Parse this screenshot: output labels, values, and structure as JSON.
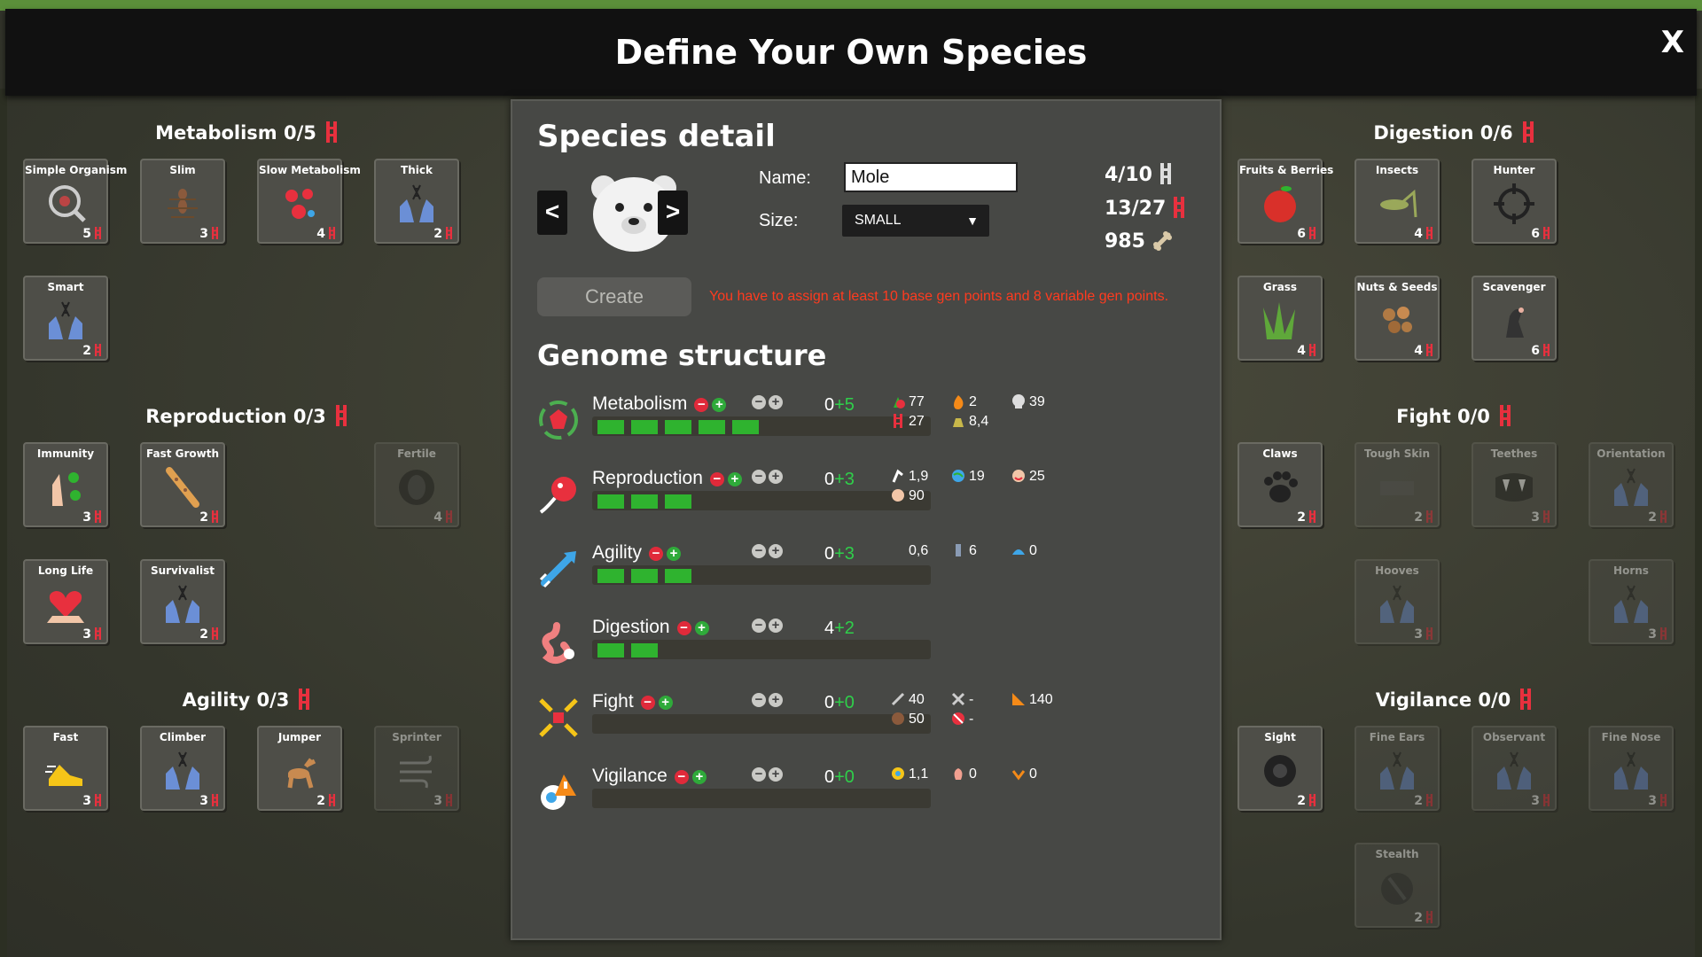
{
  "window": {
    "title": "Define Your Own Species",
    "close_label": "X"
  },
  "left_groups": [
    {
      "title": "Metabolism 0/5",
      "cards": [
        {
          "label": "Simple Organism",
          "cost": "5",
          "icon": "magnifier-bug-icon"
        },
        {
          "label": "Slim",
          "cost": "3",
          "icon": "ant-icon"
        },
        {
          "label": "Slow Metabolism",
          "cost": "4",
          "icon": "virus-icon"
        },
        {
          "label": "Thick",
          "cost": "2",
          "icon": "hands-dna-icon"
        },
        {
          "label": "Smart",
          "cost": "2",
          "icon": "hands-dna-icon"
        }
      ]
    },
    {
      "title": "Reproduction 0/3",
      "cards": [
        {
          "label": "Immunity",
          "cost": "3",
          "icon": "hand-virus-icon"
        },
        {
          "label": "Fast Growth",
          "cost": "2",
          "icon": "giraffe-icon"
        },
        {
          "label": "Fertile",
          "cost": "4",
          "icon": "egg-icon"
        },
        {
          "label": "Long Life",
          "cost": "3",
          "icon": "heart-hand-icon"
        },
        {
          "label": "Survivalist",
          "cost": "2",
          "icon": "hands-dna-icon"
        }
      ]
    },
    {
      "title": "Agility 0/3",
      "cards": [
        {
          "label": "Fast",
          "cost": "3",
          "icon": "shoe-icon"
        },
        {
          "label": "Climber",
          "cost": "3",
          "icon": "hands-dna-icon"
        },
        {
          "label": "Jumper",
          "cost": "2",
          "icon": "deer-icon"
        },
        {
          "label": "Sprinter",
          "cost": "3",
          "icon": "wind-icon"
        }
      ]
    }
  ],
  "right_groups": [
    {
      "title": "Digestion 0/6",
      "cards": [
        {
          "label": "Fruits & Berries",
          "cost": "6",
          "icon": "apple-icon"
        },
        {
          "label": "Insects",
          "cost": "4",
          "icon": "grasshopper-icon"
        },
        {
          "label": "Hunter",
          "cost": "6",
          "icon": "crosshair-icon"
        },
        {
          "label": "Grass",
          "cost": "4",
          "icon": "grass-icon"
        },
        {
          "label": "Nuts & Seeds",
          "cost": "4",
          "icon": "nuts-icon"
        },
        {
          "label": "Scavenger",
          "cost": "6",
          "icon": "vulture-icon"
        }
      ]
    },
    {
      "title": "Fight 0/0",
      "cards": [
        {
          "label": "Claws",
          "cost": "2",
          "icon": "paw-icon"
        },
        {
          "label": "Tough Skin",
          "cost": "2",
          "icon": "skin-icon"
        },
        {
          "label": "Teethes",
          "cost": "3",
          "icon": "fangs-icon"
        },
        {
          "label": "Orientation",
          "cost": "2",
          "icon": "hands-dna-icon"
        },
        {
          "label": "Hooves",
          "cost": "3",
          "icon": "hands-dna-icon"
        },
        {
          "label": "Horns",
          "cost": "3",
          "icon": "hands-dna-icon"
        }
      ]
    },
    {
      "title": "Vigilance 0/0",
      "cards": [
        {
          "label": "Sight",
          "cost": "2",
          "icon": "eye-icon"
        },
        {
          "label": "Fine Ears",
          "cost": "2",
          "icon": "hands-dna-icon"
        },
        {
          "label": "Observant",
          "cost": "3",
          "icon": "hands-dna-icon"
        },
        {
          "label": "Fine Nose",
          "cost": "3",
          "icon": "hands-dna-icon"
        },
        {
          "label": "Stealth",
          "cost": "2",
          "icon": "stealth-icon"
        }
      ]
    }
  ],
  "species": {
    "title": "Species detail",
    "prev_label": "<",
    "next_label": ">",
    "avatar_icon": "polar-bear-icon",
    "name_label": "Name:",
    "name_value": "Mole",
    "size_label": "Size:",
    "size_value": "SMALL",
    "base_points": "4/10",
    "variable_points": "13/27",
    "cost": "985",
    "create_label": "Create",
    "warning": "You have to assign at least 10 base gen points and 8 variable gen points."
  },
  "genome": {
    "title": "Genome structure",
    "rows": [
      {
        "name": "Metabolism",
        "base": "0",
        "variable": "+5",
        "filled": 5,
        "stats": [
          {
            "icon": "food-icon",
            "value": "77"
          },
          {
            "icon": "gene-icon",
            "value": "27"
          },
          {
            "icon": "fire-icon",
            "value": "2"
          },
          {
            "icon": "weight-icon",
            "value": "8,4"
          },
          {
            "icon": "skull-icon",
            "value": "39"
          }
        ]
      },
      {
        "name": "Reproduction",
        "base": "0",
        "variable": "+3",
        "filled": 3,
        "stats": [
          {
            "icon": "stork-icon",
            "value": "1,9"
          },
          {
            "icon": "baby-icon",
            "value": "90"
          },
          {
            "icon": "globe-icon",
            "value": "19"
          },
          {
            "icon": "face-icon",
            "value": "25"
          }
        ]
      },
      {
        "name": "Agility",
        "base": "0",
        "variable": "+3",
        "filled": 3,
        "stats": [
          {
            "icon": "shoe-icon",
            "value": "0,6"
          },
          {
            "icon": "climb-icon",
            "value": "6"
          },
          {
            "icon": "wave-icon",
            "value": "0"
          }
        ]
      },
      {
        "name": "Digestion",
        "base": "4",
        "variable": "+2",
        "filled": 2,
        "stats": []
      },
      {
        "name": "Fight",
        "base": "0",
        "variable": "+0",
        "filled": 0,
        "stats": [
          {
            "icon": "sword-icon",
            "value": "40"
          },
          {
            "icon": "shield-icon",
            "value": "50"
          },
          {
            "icon": "crossed-swords-icon",
            "value": "-"
          },
          {
            "icon": "no-swords-icon",
            "value": "-"
          },
          {
            "icon": "ruler-icon",
            "value": "140"
          }
        ]
      },
      {
        "name": "Vigilance",
        "base": "0",
        "variable": "+0",
        "filled": 0,
        "stats": [
          {
            "icon": "eye-icon",
            "value": "1,1"
          },
          {
            "icon": "ear-icon",
            "value": "0"
          },
          {
            "icon": "nose-icon",
            "value": "0"
          }
        ]
      }
    ]
  },
  "colors": {
    "accent_green": "#2fb32f",
    "warning_red": "#ff3b1f",
    "gene_red": "#e8303e"
  }
}
